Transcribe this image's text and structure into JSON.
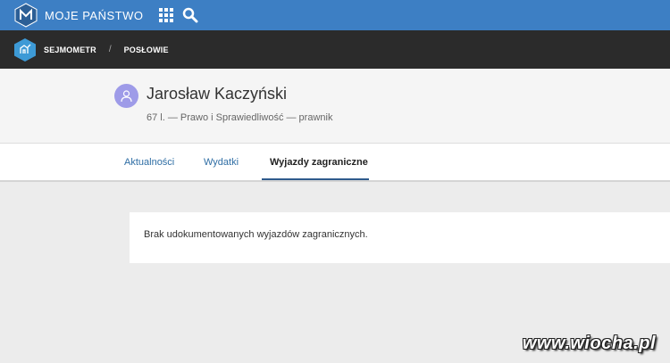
{
  "topbar": {
    "brand": "MOJE PAŃSTWO",
    "brand_color": "#3d7fc4",
    "icons": [
      "logo-m-icon",
      "apps-grid-icon",
      "search-icon"
    ]
  },
  "breadcrumb": {
    "items": [
      {
        "label": "SEJMOMETR"
      },
      {
        "label": "POSŁOWIE"
      }
    ],
    "separator": "/"
  },
  "profile": {
    "name": "Jarosław Kaczyński",
    "meta": "67 l. — Prawo i Sprawiedliwość — prawnik",
    "avatar_color": "#9e9be8"
  },
  "tabs": [
    {
      "label": "Aktualności",
      "active": false
    },
    {
      "label": "Wydatki",
      "active": false
    },
    {
      "label": "Wyjazdy zagraniczne",
      "active": true
    }
  ],
  "content": {
    "message": "Brak udokumentowanych wyjazdów zagranicznych."
  },
  "watermark": {
    "text": "www.wiocha.pl"
  }
}
